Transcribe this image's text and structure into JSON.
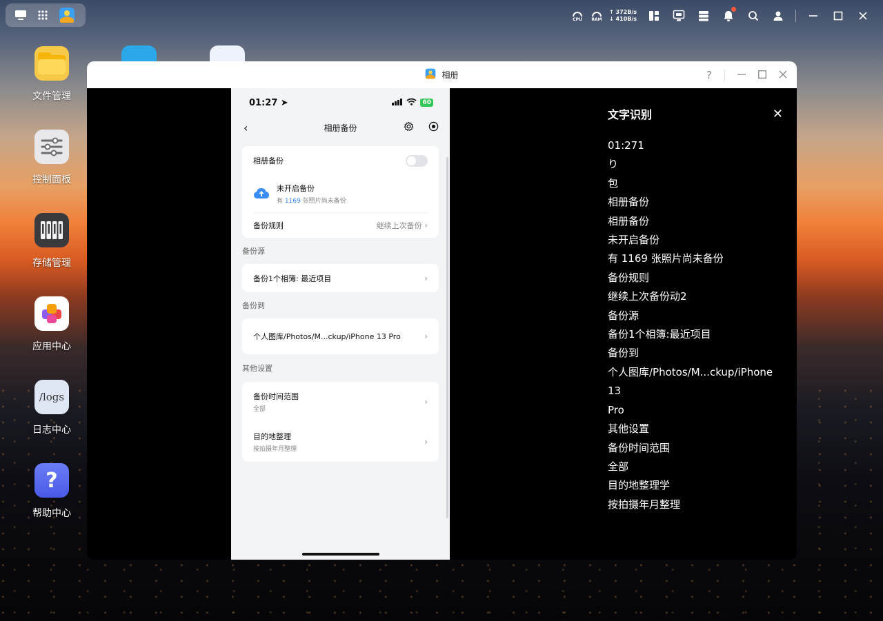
{
  "topbar": {
    "launcher_icons": [
      "desktop-icon",
      "grid-apps-icon",
      "photos-app-icon"
    ],
    "cpu_label": "CPU",
    "ram_label": "RAM",
    "upload_rate": "372B/s",
    "download_rate": "410B/s",
    "tray_icons": [
      "widgets-icon",
      "monitor-icon",
      "storage-icon",
      "bell-icon",
      "search-icon",
      "user-icon"
    ],
    "notification_dot_color": "#ff5a3c"
  },
  "desktop": {
    "icons": [
      {
        "label": "文件管理",
        "icon": "folder-icon"
      },
      {
        "label": "控制面板",
        "icon": "sliders-icon"
      },
      {
        "label": "存储管理",
        "icon": "storage-drives-icon"
      },
      {
        "label": "应用中心",
        "icon": "app-center-icon"
      },
      {
        "label": "日志中心",
        "icon": "logs-icon",
        "tile_text": "/logs"
      },
      {
        "label": "帮助中心",
        "icon": "help-icon",
        "tile_text": "?"
      }
    ]
  },
  "window": {
    "title": "相册",
    "help": "?"
  },
  "phone": {
    "time": "01:27",
    "battery": "60",
    "nav_title": "相册备份",
    "backup_toggle_label": "相册备份",
    "backup_toggle_on": false,
    "status_title": "未开启备份",
    "status_sub_prefix": "有",
    "status_sub_count": "1169",
    "status_sub_suffix": "张照片尚未备份",
    "rule_label": "备份规则",
    "rule_value": "继续上次备份",
    "source_section": "备份源",
    "source_value": "备份1个相簿: 最近项目",
    "dest_section": "备份到",
    "dest_value": "个人图库/Photos/M...ckup/iPhone 13 Pro",
    "other_section": "其他设置",
    "time_range_label": "备份时间范围",
    "time_range_value": "全部",
    "organize_label": "目的地整理",
    "organize_value": "按拍摄年月整理"
  },
  "ocr_panel": {
    "title": "文字识别",
    "lines": [
      "01:271",
      "り",
      "包",
      "相册备份",
      "相册备份",
      "未开启备份",
      "有 1169 张照片尚未备份",
      "备份规则",
      "继续上次备份动2",
      "备份源",
      "备份1个相簿:最近项目",
      "备份到",
      "个人图库/Photos/M...ckup/iPhone 13",
      "Pro",
      "其他设置",
      "备份时间范围",
      "全部",
      "目的地整理学",
      "按拍摄年月整理"
    ]
  }
}
